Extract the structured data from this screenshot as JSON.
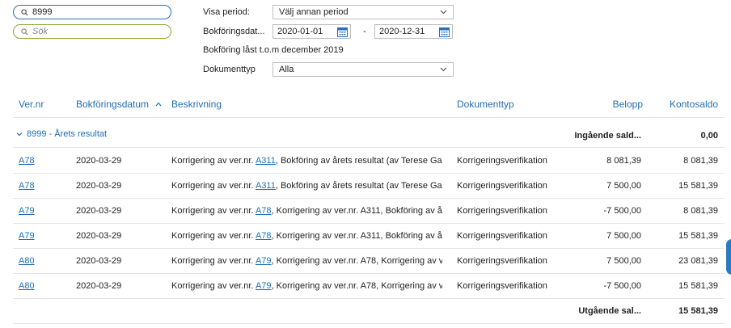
{
  "search": {
    "primary_value": "8999",
    "secondary_placeholder": "Sök"
  },
  "filters": {
    "period_label": "Visa period:",
    "period_value": "Välj annan period",
    "date_label": "Bokföringsdat...",
    "date_from": "2020-01-01",
    "date_separator": "-",
    "date_to": "2020-12-31",
    "locked_text": "Bokföring låst t.o.m december 2019",
    "doctype_label": "Dokumenttyp",
    "doctype_value": "Alla"
  },
  "table": {
    "headers": {
      "vernr": "Ver.nr",
      "date": "Bokföringsdatum",
      "description": "Beskrivning",
      "doctype": "Dokumenttyp",
      "amount": "Belopp",
      "balance": "Kontosaldo"
    },
    "sort_indicator": "^",
    "group": {
      "toggle": "˅",
      "label": "8999 - Årets resultat",
      "opening_label": "Ingående sald...",
      "opening_value": "0,00"
    },
    "rows": [
      {
        "vernr": "A78",
        "date": "2020-03-29",
        "desc_prefix": "Korrigering av ver.nr. ",
        "desc_link": "A311",
        "desc_rest": ", Bokföring av årets resultat (av Terese Ga...",
        "doctype": "Korrigeringsverifikation",
        "amount": "8 081,39",
        "balance": "8 081,39"
      },
      {
        "vernr": "A78",
        "date": "2020-03-29",
        "desc_prefix": "Korrigering av ver.nr. ",
        "desc_link": "A311",
        "desc_rest": ", Bokföring av årets resultat (av Terese Ga...",
        "doctype": "Korrigeringsverifikation",
        "amount": "7 500,00",
        "balance": "15 581,39"
      },
      {
        "vernr": "A79",
        "date": "2020-03-29",
        "desc_prefix": "Korrigering av ver.nr. ",
        "desc_link": "A78",
        "desc_rest": ", Korrigering av ver.nr. A311, Bokföring av å...",
        "doctype": "Korrigeringsverifikation",
        "amount": "-7 500,00",
        "balance": "8 081,39"
      },
      {
        "vernr": "A79",
        "date": "2020-03-29",
        "desc_prefix": "Korrigering av ver.nr. ",
        "desc_link": "A78",
        "desc_rest": ", Korrigering av ver.nr. A311, Bokföring av å...",
        "doctype": "Korrigeringsverifikation",
        "amount": "7 500,00",
        "balance": "15 581,39"
      },
      {
        "vernr": "A80",
        "date": "2020-03-29",
        "desc_prefix": "Korrigering av ver.nr. ",
        "desc_link": "A79",
        "desc_rest": ", Korrigering av ver.nr. A78, Korrigering av v...",
        "doctype": "Korrigeringsverifikation",
        "amount": "7 500,00",
        "balance": "23 081,39"
      },
      {
        "vernr": "A80",
        "date": "2020-03-29",
        "desc_prefix": "Korrigering av ver.nr. ",
        "desc_link": "A79",
        "desc_rest": ", Korrigering av ver.nr. A78, Korrigering av v...",
        "doctype": "Korrigeringsverifikation",
        "amount": "-7 500,00",
        "balance": "15 581,39"
      }
    ],
    "closing_label": "Utgående sal...",
    "closing_value": "15 581,39"
  },
  "colors": {
    "accent": "#1f6fb4",
    "search_border": "#2a6fb8",
    "search_alt_border": "#8fa83a",
    "side_tab": "#2a7bbf"
  },
  "icons": [
    "search-icon",
    "chevron-down-icon",
    "calendar-icon",
    "sort-ascending-icon",
    "collapse-icon"
  ]
}
